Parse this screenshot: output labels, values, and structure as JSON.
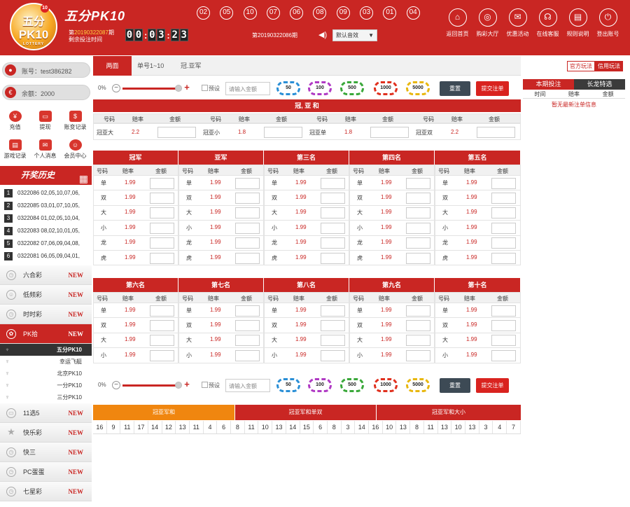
{
  "header": {
    "logo_top": "五分",
    "logo_mid": "PK10",
    "logo_sub": "LOTTERY",
    "logo_badge": "10",
    "brand": "五分PK10",
    "period_prefix": "第",
    "period_number": "20190322087",
    "period_suffix": "期",
    "remain_label": "剩余投注时间",
    "countdown": [
      "0",
      "0",
      "0",
      "3",
      "2",
      "3"
    ],
    "balls": [
      "02",
      "05",
      "10",
      "07",
      "06",
      "08",
      "09",
      "03",
      "01",
      "04"
    ],
    "last_period": "第20190322086期",
    "sound_label": "默认音效",
    "nav": [
      {
        "icon": "⌂",
        "label": "返回首页"
      },
      {
        "icon": "◎",
        "label": "购彩大厅"
      },
      {
        "icon": "✉",
        "label": "优惠活动"
      },
      {
        "icon": "☊",
        "label": "在线客服"
      },
      {
        "icon": "▤",
        "label": "规则说明"
      },
      {
        "icon": "⏻",
        "label": "登出账号"
      }
    ]
  },
  "account": {
    "user_label": "账号：test386282",
    "balance_label": "余额：2000"
  },
  "quick": [
    {
      "icon": "¥",
      "label": "充值"
    },
    {
      "icon": "▭",
      "label": "提现"
    },
    {
      "icon": "$",
      "label": "账变记录"
    },
    {
      "icon": "▤",
      "label": "游戏记录"
    },
    {
      "icon": "✉",
      "label": "个人消息"
    },
    {
      "icon": "☺",
      "label": "会员中心"
    }
  ],
  "history": {
    "title": "开奖历史",
    "rows": [
      {
        "n": "1",
        "text": "0322086  02,05,10,07,06,"
      },
      {
        "n": "2",
        "text": "0322085  03,01,07,10,05,"
      },
      {
        "n": "3",
        "text": "0322084  01,02,05,10,04,"
      },
      {
        "n": "4",
        "text": "0322083  08,02,10,01,05,"
      },
      {
        "n": "5",
        "text": "0322082  07,06,09,04,08,"
      },
      {
        "n": "6",
        "text": "0322081  06,05,09,04,01,"
      }
    ]
  },
  "lottery": {
    "new_tag": "NEW",
    "items": [
      "六合彩",
      "低频彩",
      "时时彩",
      "PK拾"
    ],
    "sub": [
      "五分PK10",
      "幸运飞艇",
      "北京PK10",
      "一分PK10",
      "三分PK10"
    ],
    "items2": [
      "11选5",
      "快乐彩",
      "快三",
      "PC蛋蛋",
      "七星彩"
    ]
  },
  "tabs": [
    "两面",
    "单号1~10",
    "冠.亚军"
  ],
  "mode": [
    "官方玩法",
    "信用玩法"
  ],
  "betbar": {
    "percent": "0%",
    "preset": "预设",
    "amount_placeholder": "请输入金额",
    "chips": [
      "50",
      "100",
      "500",
      "1000",
      "5000"
    ],
    "reset": "重置",
    "submit": "提交注单"
  },
  "gysum": {
    "title": "冠, 亚 和",
    "headers": [
      "号码",
      "赔率",
      "金额"
    ],
    "items": [
      {
        "name": "冠亚大",
        "odds": "2.2"
      },
      {
        "name": "冠亚小",
        "odds": "1.8"
      },
      {
        "name": "冠亚单",
        "odds": "1.8"
      },
      {
        "name": "冠亚双",
        "odds": "2.2"
      }
    ]
  },
  "block_headers": [
    "号码",
    "赔率",
    "金额"
  ],
  "block1": {
    "titles": [
      "冠军",
      "亚军",
      "第三名",
      "第四名",
      "第五名"
    ],
    "rows": [
      "单",
      "双",
      "大",
      "小",
      "龙",
      "虎"
    ],
    "odds": "1.99"
  },
  "block2": {
    "titles": [
      "第六名",
      "第七名",
      "第八名",
      "第九名",
      "第十名"
    ],
    "rows": [
      "单",
      "双",
      "大",
      "小"
    ],
    "odds": "1.99"
  },
  "trend": {
    "tabs": [
      "冠亚军和",
      "冠亚军和单双",
      "冠亚军和大小"
    ],
    "values": [
      "16",
      "9",
      "11",
      "17",
      "14",
      "12",
      "13",
      "11",
      "4",
      "6",
      "8",
      "11",
      "10",
      "13",
      "14",
      "15",
      "6",
      "8",
      "3",
      "14",
      "16",
      "10",
      "13",
      "8",
      "11",
      "13",
      "10",
      "13",
      "3",
      "4",
      "7"
    ]
  },
  "right": {
    "tabs": [
      "本期投注",
      "长龙特选"
    ],
    "headers": [
      "时间",
      "赔率",
      "金额"
    ],
    "empty": "暂无最新注单信息"
  }
}
